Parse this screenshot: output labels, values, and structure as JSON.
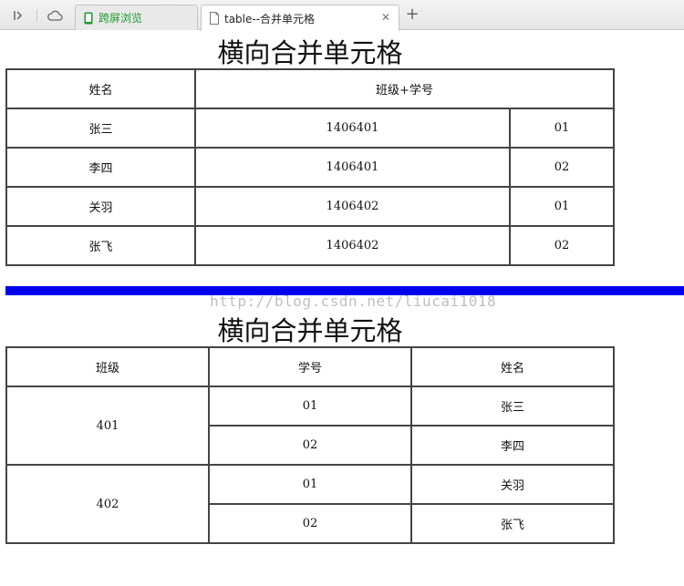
{
  "browser": {
    "tabs": [
      {
        "label": "跨屏浏览"
      },
      {
        "label": "table--合并单元格"
      }
    ]
  },
  "table1": {
    "title": "横向合并单元格",
    "header": [
      "姓名",
      "班级+学号"
    ],
    "rows": [
      [
        "张三",
        "1406401",
        "01"
      ],
      [
        "李四",
        "1406401",
        "02"
      ],
      [
        "关羽",
        "1406402",
        "01"
      ],
      [
        "张飞",
        "1406402",
        "02"
      ]
    ]
  },
  "watermark": "http://blog.csdn.net/liucai1018",
  "table2": {
    "title": "横向合并单元格",
    "header": [
      "班级",
      "学号",
      "姓名"
    ],
    "groups": [
      {
        "class": "401",
        "rows": [
          [
            "01",
            "张三"
          ],
          [
            "02",
            "李四"
          ]
        ]
      },
      {
        "class": "402",
        "rows": [
          [
            "01",
            "关羽"
          ],
          [
            "02",
            "张飞"
          ]
        ]
      }
    ]
  },
  "colors": {
    "divider": "#0000ee",
    "tab_green": "#1a9c2a"
  }
}
